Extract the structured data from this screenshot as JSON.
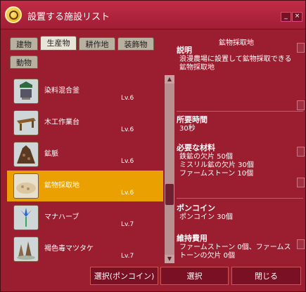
{
  "window": {
    "title": "設置する施設リスト",
    "minimize": "_",
    "close": "×"
  },
  "tabs": [
    {
      "label": "建物"
    },
    {
      "label": "生産物"
    },
    {
      "label": "耕作地"
    },
    {
      "label": "装飾物"
    },
    {
      "label": "動物"
    }
  ],
  "list": [
    {
      "name": "染料混合釜",
      "level": "Lv.6",
      "icon": "cauldron-icon"
    },
    {
      "name": "木工作業台",
      "level": "Lv.6",
      "icon": "workbench-icon"
    },
    {
      "name": "鉱脈",
      "level": "Lv.6",
      "icon": "ore-vein-icon"
    },
    {
      "name": "鉱物採取地",
      "level": "Lv.6",
      "icon": "mining-site-icon"
    },
    {
      "name": "マナハーブ",
      "level": "Lv.7",
      "icon": "mana-herb-icon"
    },
    {
      "name": "褐色毒マツタケ",
      "level": "Lv.7",
      "icon": "mushroom-icon"
    }
  ],
  "detail": {
    "facility_name": "鉱物採取地",
    "desc_header": "説明",
    "description": "浪漫農場に設置して鉱物採取できる鉱物採取地",
    "time_header": "所要時間",
    "time": "30秒",
    "materials_header": "必要な材料",
    "materials": [
      "鉄鉱の欠片 50個",
      "ミスリル鉱の欠片 30個",
      "ファームストーン 10個"
    ],
    "coin_header": "ポンコイン",
    "coin": "ポンコイン 30個",
    "upkeep_header": "維持費用",
    "upkeep": "ファームストーン 0個、ファームストーンの欠片 0個"
  },
  "buttons": {
    "select_coin": "選択(ポンコイン)",
    "select": "選択",
    "close": "閉じる"
  },
  "colors": {
    "window_bg": "#9a1e30",
    "selected_row": "#e9a000",
    "tab_active": "#e9e4d8"
  }
}
